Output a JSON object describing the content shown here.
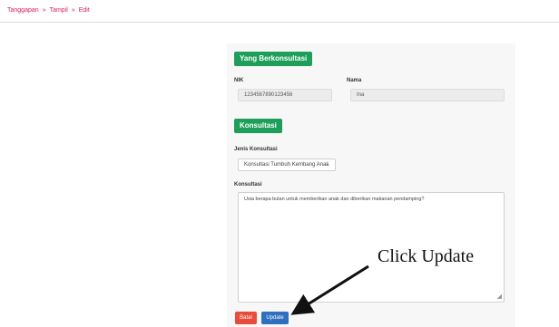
{
  "breadcrumb": {
    "items": [
      "Tanggapan",
      "Tampil",
      "Edit"
    ]
  },
  "section_yang_berkonsultasi": {
    "title": "Yang Berkonsultasi"
  },
  "nik": {
    "label": "NIK",
    "value": "1234567890123456"
  },
  "nama": {
    "label": "Nama",
    "value": "Ina"
  },
  "section_konsultasi": {
    "title": "Konsultasi"
  },
  "jenis_konsultasi": {
    "label": "Jenis Konsultasi",
    "value": "Konsultasi Tumbuh Kembang Anak"
  },
  "konsultasi": {
    "label": "Konsultasi",
    "value": "Usia berapa bulan untuk memberikan anak dan diberikan makanan pendamping?"
  },
  "buttons": {
    "back": "Batal",
    "update": "Update"
  },
  "annotation": {
    "text": "Click Update"
  },
  "colors": {
    "badge": "#1e9e5b",
    "back_button": "#e74c3c",
    "update_button": "#2f6fbf",
    "breadcrumb": "#d81b60"
  }
}
